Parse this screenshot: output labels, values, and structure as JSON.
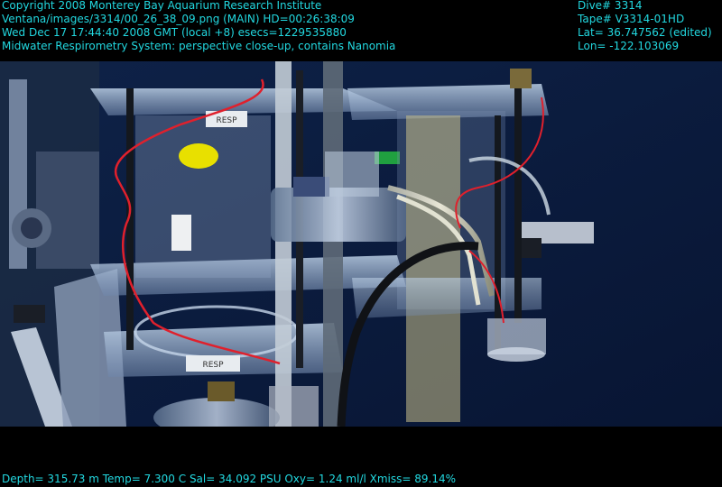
{
  "overlay": {
    "copyright": "Copyright 2008 Monterey Bay Aquarium Research Institute",
    "image_path": "Ventana/images/3314/00_26_38_09.png (MAIN)  HD=00:26:38:09",
    "datetime": "Wed Dec 17 17:44:40 2008 GMT (local +8)  esecs=1229535880",
    "description": "Midwater Respirometry System: perspective close-up, contains Nanomia",
    "dive": "Dive# 3314",
    "tape": "Tape# V3314-01HD",
    "lat": "Lat= 36.747562 (edited)",
    "lon": "Lon= -122.103069",
    "sensors": "Depth= 315.73 m  Temp= 7.300 C  Sal= 34.092 PSU  Oxy= 1.24 ml/l  Xmiss= 89.14%"
  },
  "scene": {
    "chamber_labels": [
      "RESP",
      "RESP",
      "RESP"
    ],
    "colors": {
      "water": "#0b1a3c",
      "frame_acrylic": "#9fb0c8",
      "overlay_text": "#22d8e0",
      "red_tubing": "#e0202c",
      "yellow_float": "#e8e000"
    }
  }
}
